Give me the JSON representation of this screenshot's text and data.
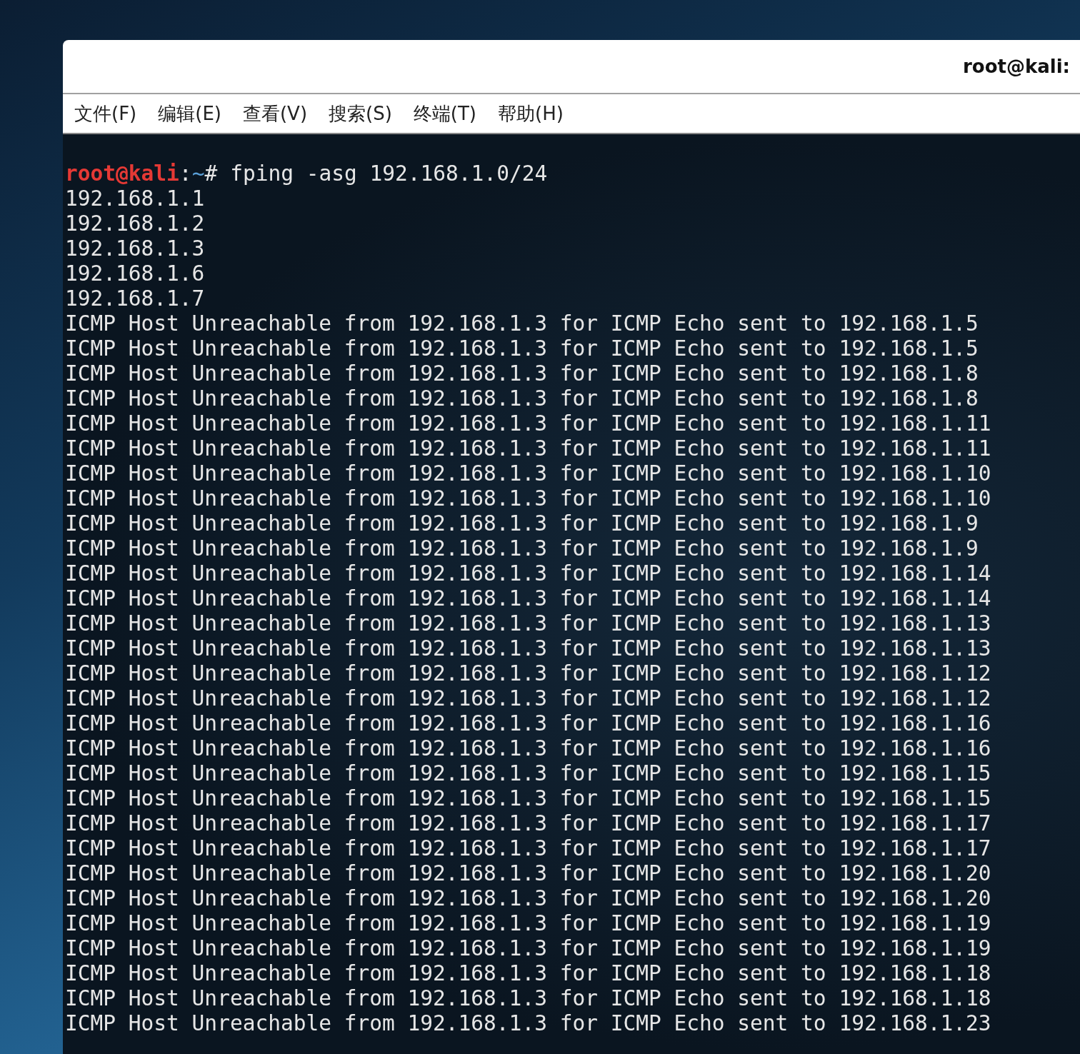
{
  "window": {
    "title": "root@kali:"
  },
  "menu": [
    "文件(F)",
    "编辑(E)",
    "查看(V)",
    "搜索(S)",
    "终端(T)",
    "帮助(H)"
  ],
  "terminal": {
    "prompt": {
      "user_host": "root@kali",
      "separator": ":",
      "path": "~",
      "symbol": "#",
      "command": "fping -asg 192.168.1.0/24"
    },
    "lines": [
      "192.168.1.1",
      "192.168.1.2",
      "192.168.1.3",
      "192.168.1.6",
      "192.168.1.7",
      "ICMP Host Unreachable from 192.168.1.3 for ICMP Echo sent to 192.168.1.5",
      "ICMP Host Unreachable from 192.168.1.3 for ICMP Echo sent to 192.168.1.5",
      "ICMP Host Unreachable from 192.168.1.3 for ICMP Echo sent to 192.168.1.8",
      "ICMP Host Unreachable from 192.168.1.3 for ICMP Echo sent to 192.168.1.8",
      "ICMP Host Unreachable from 192.168.1.3 for ICMP Echo sent to 192.168.1.11",
      "ICMP Host Unreachable from 192.168.1.3 for ICMP Echo sent to 192.168.1.11",
      "ICMP Host Unreachable from 192.168.1.3 for ICMP Echo sent to 192.168.1.10",
      "ICMP Host Unreachable from 192.168.1.3 for ICMP Echo sent to 192.168.1.10",
      "ICMP Host Unreachable from 192.168.1.3 for ICMP Echo sent to 192.168.1.9",
      "ICMP Host Unreachable from 192.168.1.3 for ICMP Echo sent to 192.168.1.9",
      "ICMP Host Unreachable from 192.168.1.3 for ICMP Echo sent to 192.168.1.14",
      "ICMP Host Unreachable from 192.168.1.3 for ICMP Echo sent to 192.168.1.14",
      "ICMP Host Unreachable from 192.168.1.3 for ICMP Echo sent to 192.168.1.13",
      "ICMP Host Unreachable from 192.168.1.3 for ICMP Echo sent to 192.168.1.13",
      "ICMP Host Unreachable from 192.168.1.3 for ICMP Echo sent to 192.168.1.12",
      "ICMP Host Unreachable from 192.168.1.3 for ICMP Echo sent to 192.168.1.12",
      "ICMP Host Unreachable from 192.168.1.3 for ICMP Echo sent to 192.168.1.16",
      "ICMP Host Unreachable from 192.168.1.3 for ICMP Echo sent to 192.168.1.16",
      "ICMP Host Unreachable from 192.168.1.3 for ICMP Echo sent to 192.168.1.15",
      "ICMP Host Unreachable from 192.168.1.3 for ICMP Echo sent to 192.168.1.15",
      "ICMP Host Unreachable from 192.168.1.3 for ICMP Echo sent to 192.168.1.17",
      "ICMP Host Unreachable from 192.168.1.3 for ICMP Echo sent to 192.168.1.17",
      "ICMP Host Unreachable from 192.168.1.3 for ICMP Echo sent to 192.168.1.20",
      "ICMP Host Unreachable from 192.168.1.3 for ICMP Echo sent to 192.168.1.20",
      "ICMP Host Unreachable from 192.168.1.3 for ICMP Echo sent to 192.168.1.19",
      "ICMP Host Unreachable from 192.168.1.3 for ICMP Echo sent to 192.168.1.19",
      "ICMP Host Unreachable from 192.168.1.3 for ICMP Echo sent to 192.168.1.18",
      "ICMP Host Unreachable from 192.168.1.3 for ICMP Echo sent to 192.168.1.18",
      "ICMP Host Unreachable from 192.168.1.3 for ICMP Echo sent to 192.168.1.23"
    ]
  }
}
